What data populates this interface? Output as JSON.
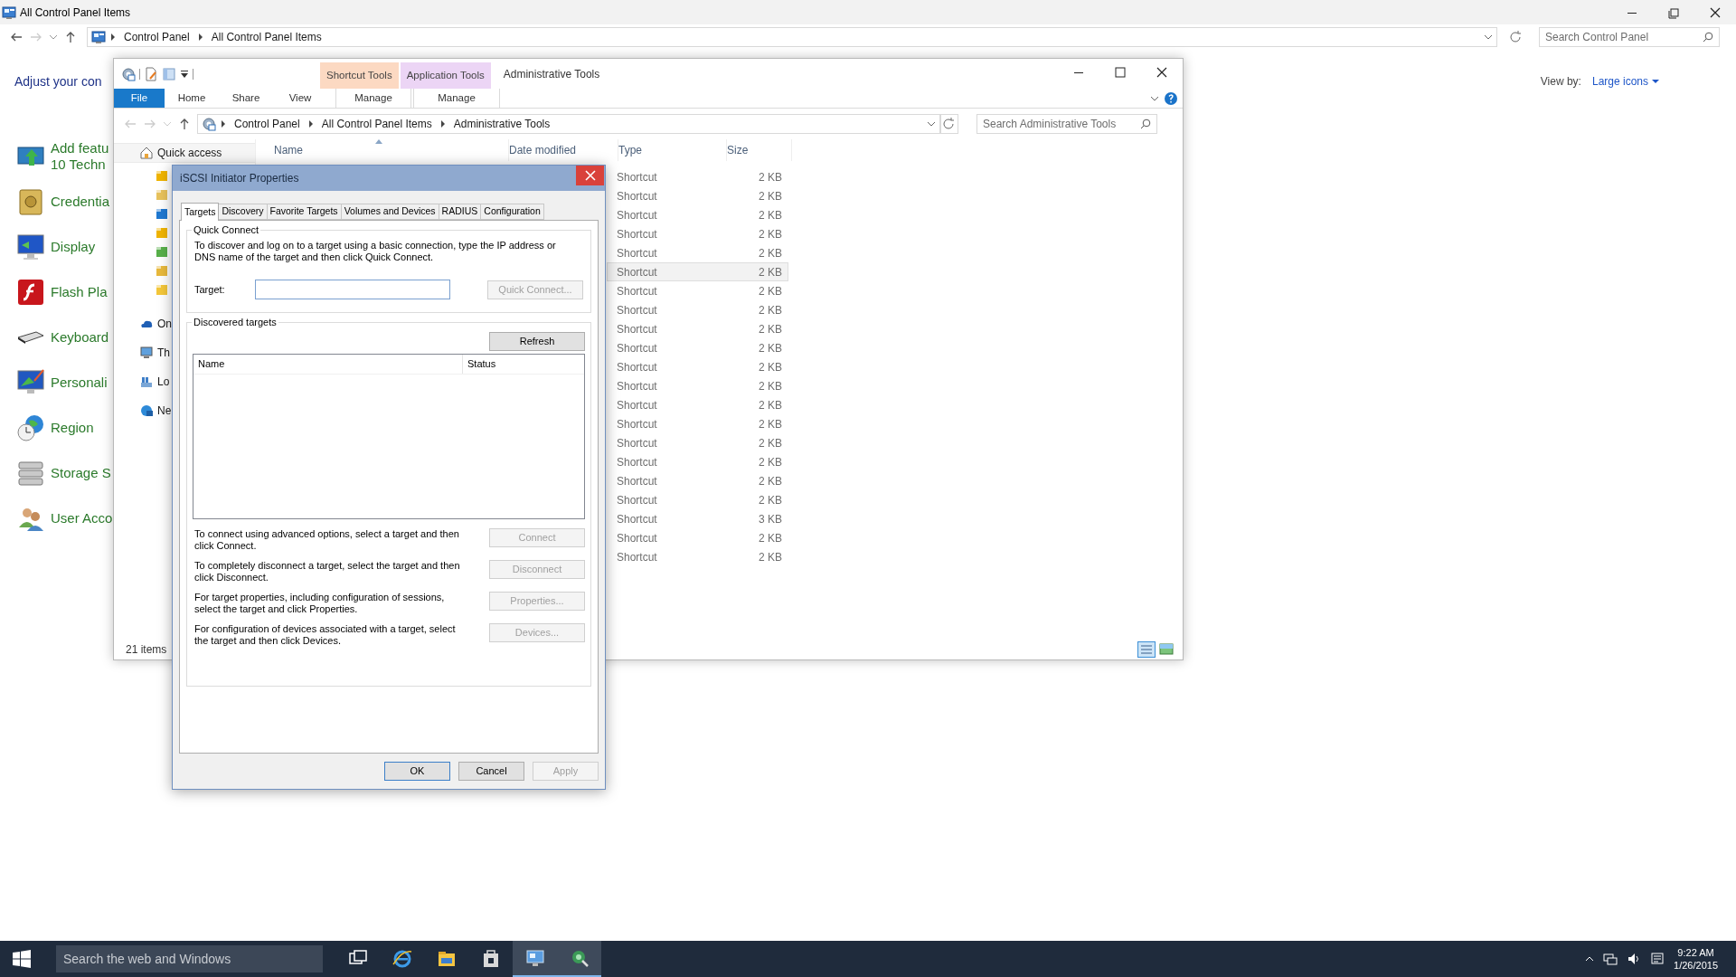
{
  "control_panel": {
    "title": "All Control Panel Items",
    "breadcrumb": [
      "Control Panel",
      "All Control Panel Items"
    ],
    "search": {
      "placeholder": "Search Control Panel"
    },
    "heading": "Adjust your con",
    "view_by": {
      "label": "View by:",
      "value": "Large icons"
    },
    "items": [
      {
        "kind": "features",
        "lines": [
          "Add featu",
          "10 Techn"
        ]
      },
      {
        "kind": "vault",
        "lines": [
          "Credentia"
        ]
      },
      {
        "kind": "display",
        "lines": [
          "Display"
        ]
      },
      {
        "kind": "flash",
        "lines": [
          "Flash Pla"
        ]
      },
      {
        "kind": "keyboard",
        "lines": [
          "Keyboard"
        ]
      },
      {
        "kind": "personalize",
        "lines": [
          "Personali"
        ]
      },
      {
        "kind": "region",
        "lines": [
          "Region"
        ]
      },
      {
        "kind": "storage",
        "lines": [
          "Storage S"
        ]
      },
      {
        "kind": "users",
        "lines": [
          "User Acco"
        ]
      }
    ]
  },
  "explorer": {
    "title": "Administrative Tools",
    "context_groups": [
      {
        "group": "Shortcut Tools",
        "tab": "Manage",
        "color": "#fcd9c2"
      },
      {
        "group": "Application Tools",
        "tab": "Manage",
        "color": "#ecd5f5"
      }
    ],
    "ribbon_tabs": [
      {
        "label": "File",
        "kind": "file"
      },
      {
        "label": "Home",
        "kind": "tab"
      },
      {
        "label": "Share",
        "kind": "tab"
      },
      {
        "label": "View",
        "kind": "tab"
      }
    ],
    "breadcrumb": [
      "Control Panel",
      "All Control Panel Items",
      "Administrative Tools"
    ],
    "search": {
      "placeholder": "Search Administrative Tools"
    },
    "nav": [
      {
        "label": "Quick access",
        "kind": "home"
      },
      {
        "label": "On",
        "kind": "cloud"
      },
      {
        "label": "Th",
        "kind": "pc"
      },
      {
        "label": "Lo",
        "kind": "library"
      },
      {
        "label": "Ne",
        "kind": "network"
      }
    ],
    "columns": [
      "Name",
      "Date modified",
      "Type",
      "Size"
    ],
    "rows": [
      {
        "type": "Shortcut",
        "size": "2 KB",
        "hovered": false
      },
      {
        "type": "Shortcut",
        "size": "2 KB",
        "hovered": false
      },
      {
        "type": "Shortcut",
        "size": "2 KB",
        "hovered": false
      },
      {
        "type": "Shortcut",
        "size": "2 KB",
        "hovered": false
      },
      {
        "type": "Shortcut",
        "size": "2 KB",
        "hovered": false
      },
      {
        "type": "Shortcut",
        "size": "2 KB",
        "hovered": true
      },
      {
        "type": "Shortcut",
        "size": "2 KB",
        "hovered": false
      },
      {
        "type": "Shortcut",
        "size": "2 KB",
        "hovered": false
      },
      {
        "type": "Shortcut",
        "size": "2 KB",
        "hovered": false
      },
      {
        "type": "Shortcut",
        "size": "2 KB",
        "hovered": false
      },
      {
        "type": "Shortcut",
        "size": "2 KB",
        "hovered": false
      },
      {
        "type": "Shortcut",
        "size": "2 KB",
        "hovered": false
      },
      {
        "type": "Shortcut",
        "size": "2 KB",
        "hovered": false
      },
      {
        "type": "Shortcut",
        "size": "2 KB",
        "hovered": false
      },
      {
        "type": "Shortcut",
        "size": "2 KB",
        "hovered": false
      },
      {
        "type": "Shortcut",
        "size": "2 KB",
        "hovered": false
      },
      {
        "type": "Shortcut",
        "size": "2 KB",
        "hovered": false
      },
      {
        "type": "Shortcut",
        "size": "2 KB",
        "hovered": false
      },
      {
        "type": "Shortcut",
        "size": "3 KB",
        "hovered": false
      },
      {
        "type": "Shortcut",
        "size": "2 KB",
        "hovered": false
      },
      {
        "type": "Shortcut",
        "size": "2 KB",
        "hovered": false
      }
    ],
    "status": "21 items"
  },
  "dialog": {
    "title": "iSCSI Initiator Properties",
    "tabs": [
      {
        "label": "Targets",
        "selected": true
      },
      {
        "label": "Discovery",
        "selected": false
      },
      {
        "label": "Favorite Targets",
        "selected": false
      },
      {
        "label": "Volumes and Devices",
        "selected": false
      },
      {
        "label": "RADIUS",
        "selected": false
      },
      {
        "label": "Configuration",
        "selected": false
      }
    ],
    "quick_connect": {
      "legend": "Quick Connect",
      "description": "To discover and log on to a target using a basic connection, type the IP address or DNS name of the target and then click Quick Connect.",
      "target_label": "Target:",
      "button": {
        "label": "Quick Connect...",
        "disabled": true
      }
    },
    "discovered": {
      "legend": "Discovered targets",
      "refresh": {
        "label": "Refresh",
        "disabled": false
      },
      "columns": [
        "Name",
        "Status"
      ]
    },
    "actions": [
      {
        "text": "To connect using advanced options, select a target and then click Connect.",
        "button": {
          "label": "Connect",
          "disabled": true
        }
      },
      {
        "text": "To completely disconnect a target, select the target and then click Disconnect.",
        "button": {
          "label": "Disconnect",
          "disabled": true
        }
      },
      {
        "text": "For target properties, including configuration of sessions, select the target and click Properties.",
        "button": {
          "label": "Properties...",
          "disabled": true
        }
      },
      {
        "text": "For configuration of devices associated with a target, select the target and then click Devices.",
        "button": {
          "label": "Devices...",
          "disabled": true
        }
      }
    ],
    "footer": [
      {
        "label": "OK",
        "disabled": false,
        "default": true
      },
      {
        "label": "Cancel",
        "disabled": false,
        "default": false
      },
      {
        "label": "Apply",
        "disabled": true,
        "default": false
      }
    ]
  },
  "taskbar": {
    "search": {
      "placeholder": "Search the web and Windows"
    },
    "apps": [
      {
        "kind": "taskview",
        "active": false
      },
      {
        "kind": "ie",
        "active": false
      },
      {
        "kind": "explorer",
        "active": false
      },
      {
        "kind": "store",
        "active": false
      },
      {
        "kind": "controlpanel",
        "active": true
      },
      {
        "kind": "iscsi",
        "active": true
      }
    ],
    "time": "9:22 AM",
    "date": "1/26/2015"
  }
}
